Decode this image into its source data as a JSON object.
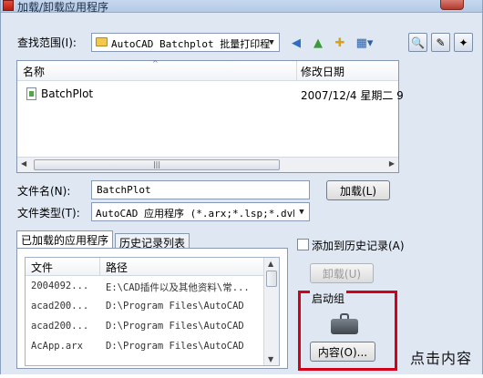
{
  "window": {
    "title": "加载/卸载应用程序"
  },
  "toolbar": {
    "lookin_label": "查找范围(I):",
    "lookin_value": "AutoCAD Batchplot 批量打印程"
  },
  "filelist": {
    "columns": [
      "名称",
      "修改日期"
    ],
    "rows": [
      {
        "name": "BatchPlot",
        "date": "2007/12/4 星期二 9"
      }
    ]
  },
  "filename": {
    "label": "文件名(N):",
    "value": "BatchPlot"
  },
  "filetype": {
    "label": "文件类型(T):",
    "value": "AutoCAD 应用程序 (*.arx;*.lsp;*.dvb;"
  },
  "buttons": {
    "load": "加载(L)",
    "unload": "卸载(U)",
    "contents": "内容(O)..."
  },
  "tabs": [
    "已加载的应用程序",
    "历史记录列表"
  ],
  "loaded_table": {
    "columns": [
      "文件",
      "路径"
    ],
    "rows": [
      {
        "file": "2004092...",
        "path": "E:\\CAD插件以及其他资料\\常..."
      },
      {
        "file": "acad200...",
        "path": "D:\\Program Files\\AutoCAD"
      },
      {
        "file": "acad200...",
        "path": "D:\\Program Files\\AutoCAD"
      },
      {
        "file": "AcApp.arx",
        "path": "D:\\Program Files\\AutoCAD"
      }
    ]
  },
  "history_checkbox": {
    "label": "添加到历史记录(A)",
    "checked": false
  },
  "startup_group": {
    "label": "启动组"
  },
  "caption": "点击内容"
}
